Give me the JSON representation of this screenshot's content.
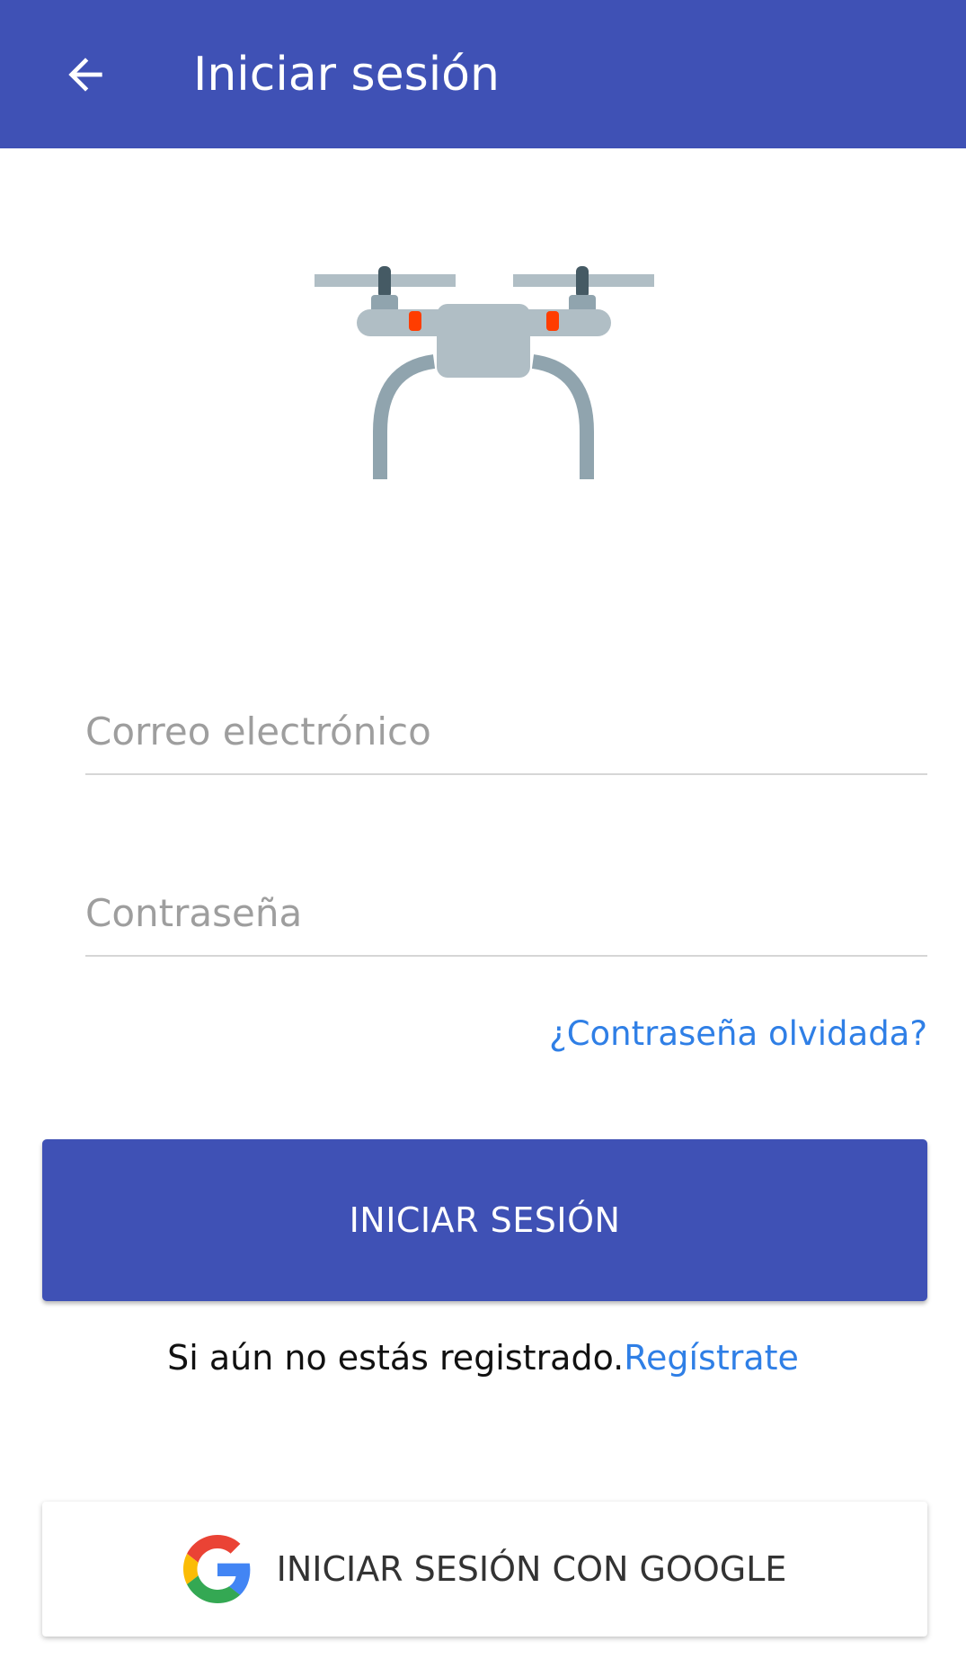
{
  "app_bar": {
    "title": "Iniciar sesión",
    "back_icon": "arrow-back-icon",
    "background_color": "#3f51b5"
  },
  "illustration": {
    "icon": "drone-icon"
  },
  "form": {
    "email_placeholder": "Correo electrónico",
    "email_value": "",
    "password_placeholder": "Contraseña",
    "password_value": "",
    "forgot_password_link": "¿Contraseña olvidada?",
    "login_button_label": "INICIAR SESIÓN"
  },
  "register": {
    "prompt_text": "Si aún no estás registrado.",
    "link_text": "Regístrate"
  },
  "google_sign_in": {
    "label": "INICIAR SESIÓN CON GOOGLE",
    "icon": "google-logo-icon"
  },
  "colors": {
    "primary": "#3f51b5",
    "link": "#2f7fe6",
    "drone_body": "#b0bec5",
    "drone_accent": "#ff3d00"
  }
}
